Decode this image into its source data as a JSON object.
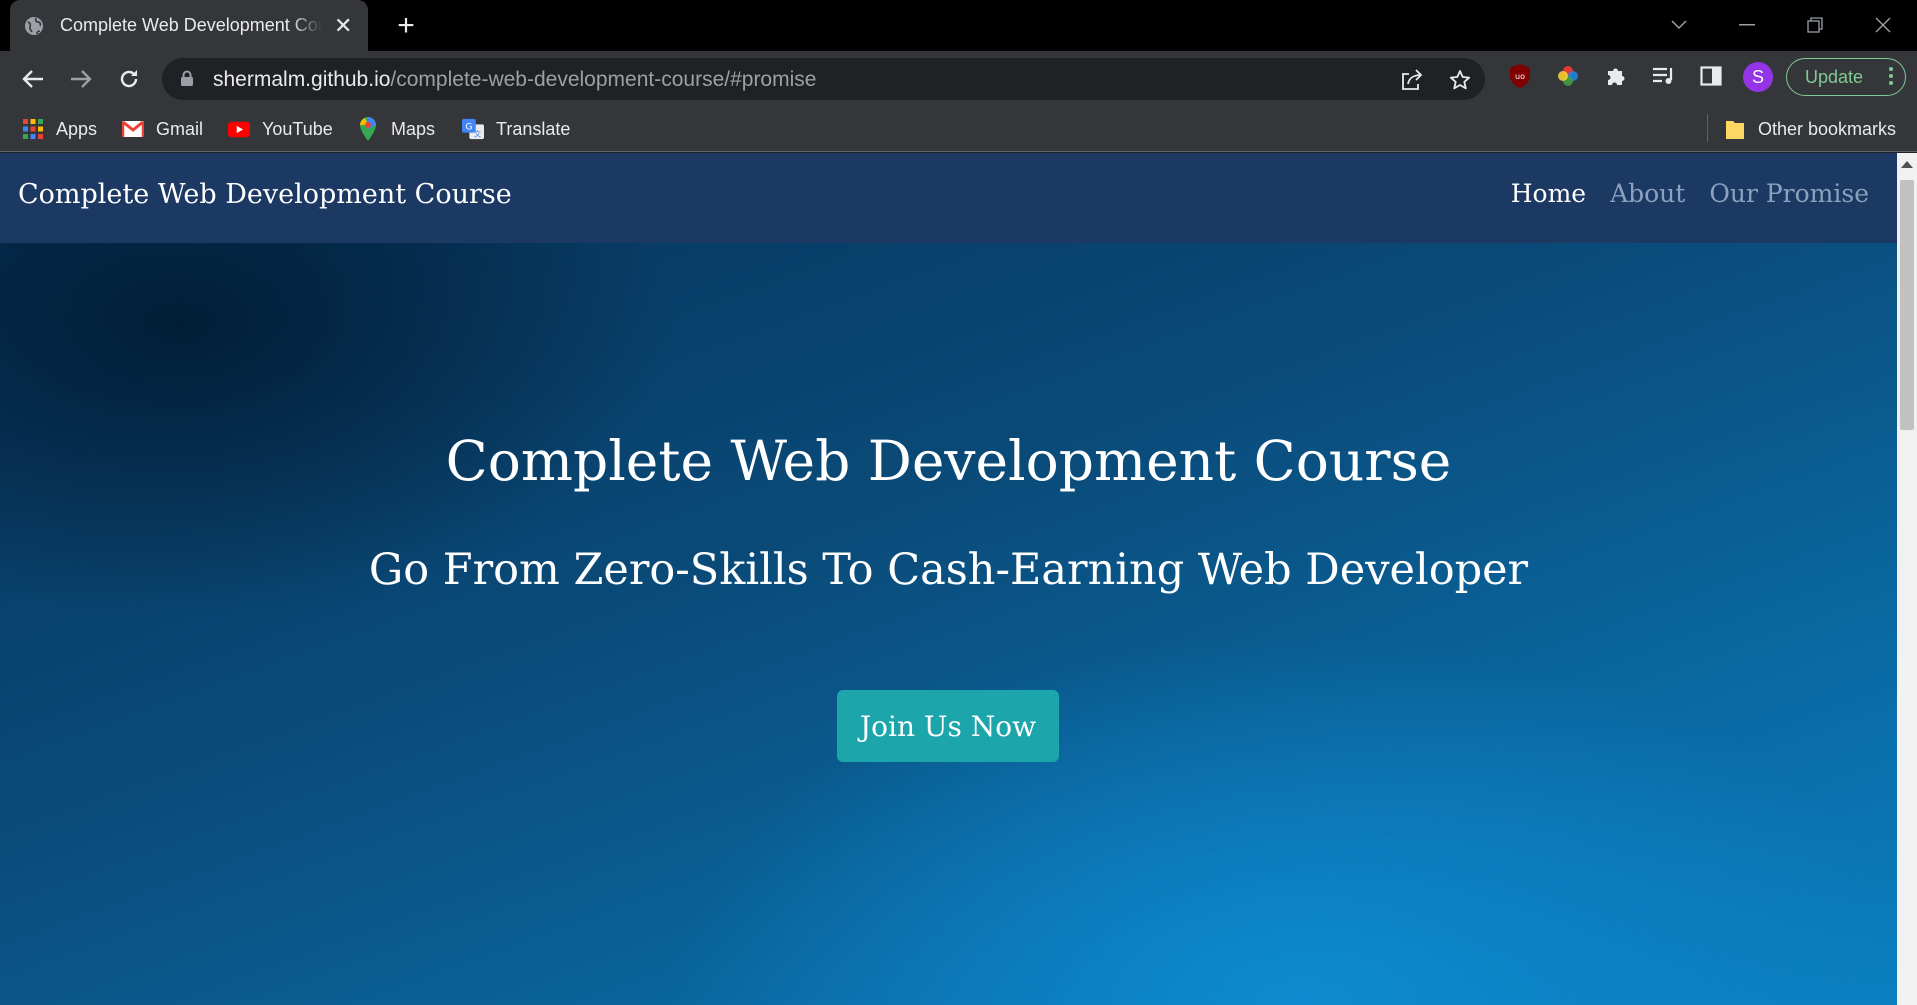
{
  "browser": {
    "tab": {
      "title": "Complete Web Development Course",
      "favicon": "globe-icon"
    },
    "address": {
      "host": "shermalm.github.io",
      "path": "/complete-web-development-course/#promise"
    },
    "profile_initial": "S",
    "update_label": "Update",
    "bookmarks": [
      {
        "label": "Apps",
        "icon": "apps-grid-icon"
      },
      {
        "label": "Gmail",
        "icon": "gmail-icon"
      },
      {
        "label": "YouTube",
        "icon": "youtube-icon"
      },
      {
        "label": "Maps",
        "icon": "maps-pin-icon"
      },
      {
        "label": "Translate",
        "icon": "translate-icon"
      }
    ],
    "other_bookmarks": "Other bookmarks"
  },
  "site": {
    "brand": "Complete Web Development Course",
    "nav": [
      {
        "label": "Home",
        "active": true
      },
      {
        "label": "About",
        "active": false
      },
      {
        "label": "Our Promise",
        "active": false
      }
    ],
    "hero": {
      "title": "Complete Web Development Course",
      "subtitle": "Go From Zero-Skills To Cash-Earning Web Developer",
      "cta": "Join Us Now"
    }
  },
  "colors": {
    "navbar": "#1c3964",
    "cta": "#1da5ac",
    "hero_dark": "#06335a",
    "hero_light": "#0b7fbf",
    "update_green": "#81c995",
    "avatar": "#9334e6"
  }
}
